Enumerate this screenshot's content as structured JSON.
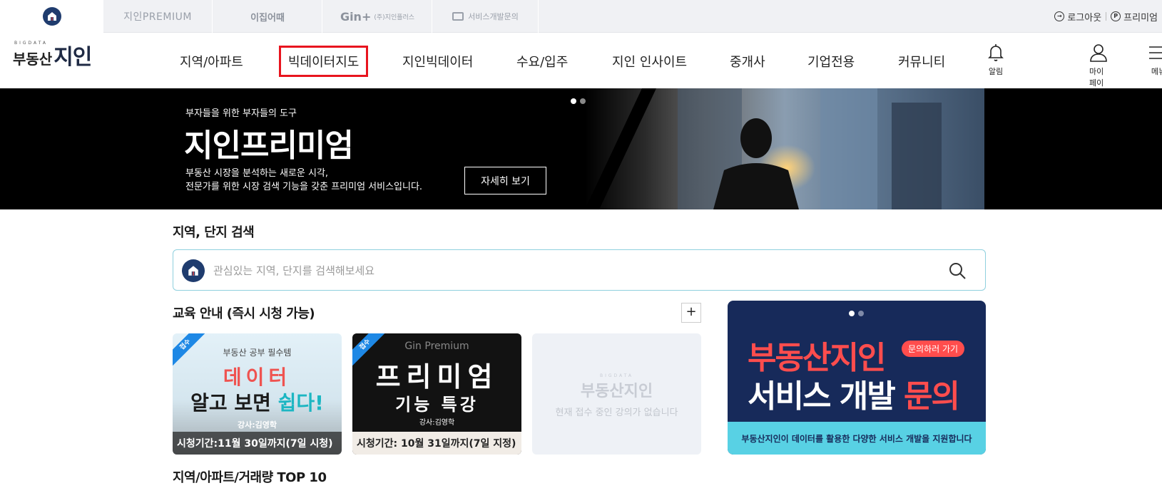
{
  "topbar": {
    "family_sites": [
      {
        "label": "지인PREMIUM"
      },
      {
        "label": "이집어때"
      },
      {
        "label": "Gin+",
        "sub": "(주)지인플러스"
      },
      {
        "label": "서비스개발문의"
      }
    ],
    "logout": "로그아웃",
    "premium": "프리미엄"
  },
  "header": {
    "logo_pre": "부동산",
    "logo_small": "BIGDATA",
    "logo_main": "지인",
    "nav": [
      "지역/아파트",
      "빅데이터지도",
      "지인빅데이터",
      "수요/입주",
      "지인 인사이트",
      "중개사",
      "기업전용",
      "커뮤니티"
    ],
    "active_index": 1,
    "icons": [
      {
        "label": "알림",
        "icon": "bell-icon"
      },
      {
        "label": "마이페이지",
        "icon": "user-icon"
      },
      {
        "label": "메뉴",
        "icon": "menu-icon"
      }
    ]
  },
  "banner": {
    "sub": "부자들을 위한 부자들의 도구",
    "title": "지인프리미엄",
    "desc1": "부동산 시장을 분석하는 새로운 시각,",
    "desc2": "전문가를 위한 시장 검색 기능을 갖춘 프리미엄 서비스입니다.",
    "more": "자세히 보기"
  },
  "search": {
    "title": "지역, 단지 검색",
    "placeholder": "관심있는 지역, 단지를 검색해보세요"
  },
  "education": {
    "title": "교육 안내 (즉시 시청 가능)",
    "plus": "+",
    "card1": {
      "ribbon": "접수",
      "line1": "부동산 공부 필수템",
      "line2": "데이터",
      "line3a": "알고 보면 ",
      "line3b": "쉽다!",
      "instructor": "강사:김영학",
      "period": "시청기간:11월 30일까지(7일 시청)"
    },
    "card2": {
      "ribbon": "접수",
      "line1": "Gin Premium",
      "line2": "프리미엄",
      "line3": "기능 특강",
      "instructor": "강사:김영학",
      "period": "시청기간: 10월 31일까지(7일 지정)"
    },
    "card3": {
      "logo_small": "BIGDATA",
      "logo": "부동산지인",
      "empty": "현재 접수 중인 강의가 없습니다"
    }
  },
  "promo": {
    "line1": "부동산지인",
    "pill": "문의하러 가기",
    "line2a": "서비스 개발 ",
    "line2b": "문의",
    "bar": "부동산지인이 데이터를 활용한 다양한 서비스 개발을 지원합니다"
  },
  "top10": {
    "title": "지역/아파트/거래량 TOP 10"
  }
}
